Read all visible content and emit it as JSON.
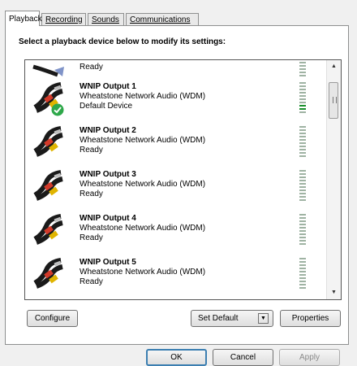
{
  "tabs": [
    {
      "label": "Playback",
      "active": true
    },
    {
      "label": "Recording",
      "active": false
    },
    {
      "label": "Sounds",
      "active": false
    },
    {
      "label": "Communications",
      "active": false
    }
  ],
  "instruction": "Select a playback device below to modify its settings:",
  "devices": [
    {
      "name": "",
      "description": "",
      "status": "Ready"
    },
    {
      "name": "WNIP Output 1",
      "description": "Wheatstone Network Audio (WDM)",
      "status": "Default Device",
      "default": true
    },
    {
      "name": "WNIP Output 2",
      "description": "Wheatstone Network Audio (WDM)",
      "status": "Ready"
    },
    {
      "name": "WNIP Output 3",
      "description": "Wheatstone Network Audio (WDM)",
      "status": "Ready"
    },
    {
      "name": "WNIP Output 4",
      "description": "Wheatstone Network Audio (WDM)",
      "status": "Ready"
    },
    {
      "name": "WNIP Output 5",
      "description": "Wheatstone Network Audio (WDM)",
      "status": "Ready"
    }
  ],
  "buttons": {
    "configure": "Configure",
    "set_default": "Set Default",
    "properties": "Properties",
    "ok": "OK",
    "cancel": "Cancel",
    "apply": "Apply"
  },
  "icons": {
    "device": "speaker-cable-icon",
    "default_check": "green-check-icon",
    "meter": "level-meter-icon"
  },
  "colors": {
    "meter_idle": "#9fb3a3",
    "meter_active": "#1a8f2c",
    "check": "#2ea84a",
    "cable_red": "#d23a2a",
    "cable_yellow": "#e0b400"
  }
}
